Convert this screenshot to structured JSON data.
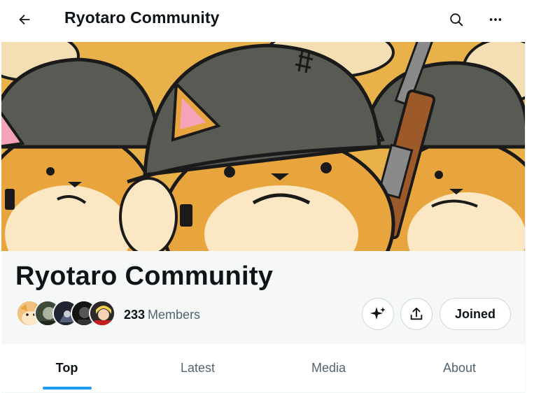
{
  "header": {
    "title": "Ryotaro Community",
    "back_icon": "arrow-left-icon",
    "search_icon": "search-icon",
    "more_icon": "more-horizontal-icon"
  },
  "community": {
    "name": "Ryotaro Community",
    "member_count": "233",
    "member_label": "Members",
    "joined_label": "Joined"
  },
  "tabs": [
    {
      "label": "Top",
      "active": true
    },
    {
      "label": "Latest",
      "active": false
    },
    {
      "label": "Media",
      "active": false
    },
    {
      "label": "About",
      "active": false
    }
  ],
  "colors": {
    "accent": "#1d9bf0",
    "text_primary": "#0f1419",
    "text_secondary": "#536471",
    "banner_background": "#e8b14a"
  }
}
